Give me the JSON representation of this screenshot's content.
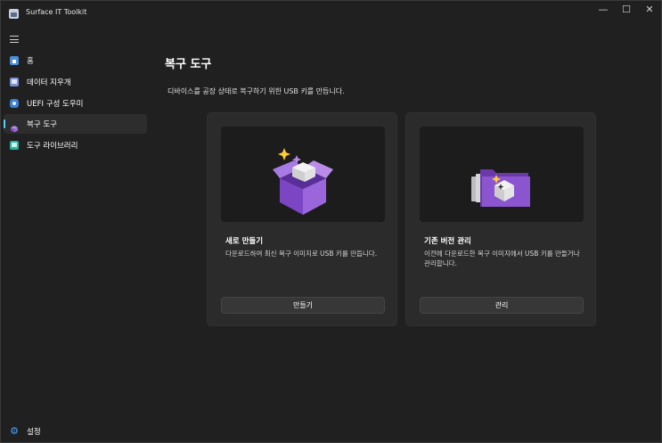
{
  "window": {
    "title": "Surface IT Toolkit",
    "minimize_glyph": "—",
    "maximize_glyph": "☐",
    "close_glyph": "✕"
  },
  "sidebar": {
    "items": [
      {
        "label": "홈",
        "icon": "home-icon"
      },
      {
        "label": "데이터 지우개",
        "icon": "data-eraser-icon"
      },
      {
        "label": "UEFI 구성 도우미",
        "icon": "uefi-icon"
      },
      {
        "label": "복구 도구",
        "icon": "recovery-icon",
        "active": true
      },
      {
        "label": "도구 라이브러리",
        "icon": "library-icon"
      }
    ],
    "settings_label": "설정"
  },
  "main": {
    "title": "복구 도구",
    "description": "디바이스를 공장 상태로 복구하기 위한 USB 키를 만듭니다.",
    "cards": [
      {
        "title": "새로 만들기",
        "description": "다운로드하여 최신 복구 이미지로 USB 키를 만듭니다.",
        "button": "만들기",
        "art": "purple-box-icon"
      },
      {
        "title": "기존 버전 관리",
        "description": "이전에 다운로드한 복구 이미지에서 USB 키를 만들거나 관리합니다.",
        "button": "관리",
        "art": "folder-box-icon"
      }
    ]
  },
  "colors": {
    "background": "#202020",
    "card": "#2b2b2b",
    "accent": "#60cdff",
    "purple": "#8b5cc7"
  }
}
